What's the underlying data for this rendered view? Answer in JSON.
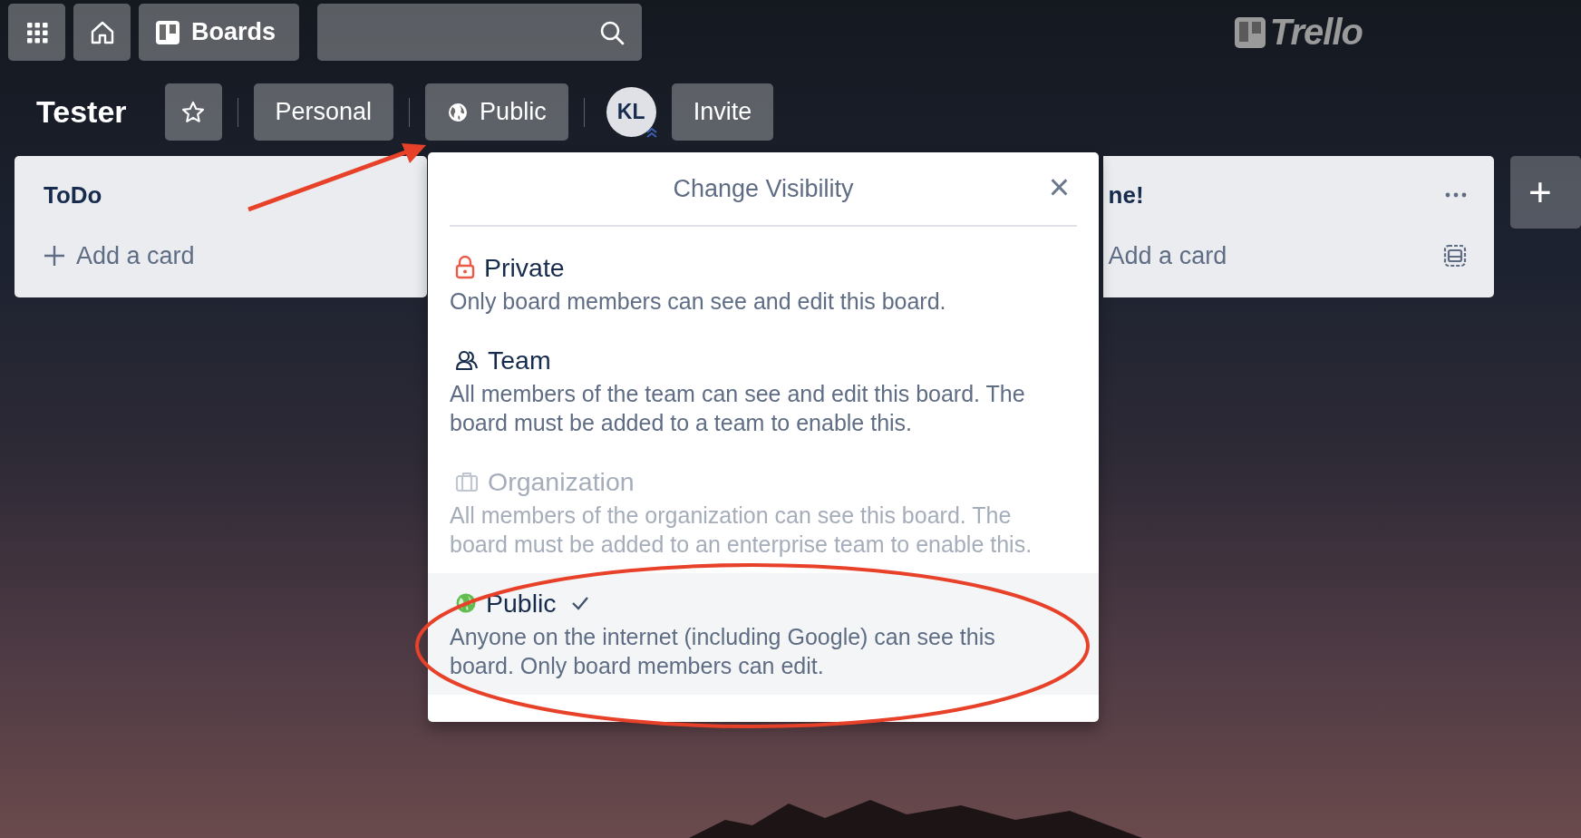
{
  "header": {
    "boards_label": "Boards",
    "logo_text": "Trello"
  },
  "board_bar": {
    "title": "Tester",
    "buttons": [
      {
        "kind": "star"
      },
      {
        "kind": "text",
        "label": "Personal"
      },
      {
        "kind": "globe",
        "label": "Public"
      }
    ],
    "member": {
      "initials": "KL"
    },
    "invite_label": "Invite"
  },
  "lists": [
    {
      "title": "ToDo",
      "add_label": "Add a card",
      "add_icon": true,
      "menu": false,
      "template_icon": false
    },
    {
      "title": "ne!",
      "add_label": "Add a card",
      "add_icon": false,
      "menu": true,
      "template_icon": true
    }
  ],
  "add_list": {
    "label": "+"
  },
  "popover": {
    "title": "Change Visibility",
    "close": "×",
    "options": [
      {
        "kind": "private",
        "title": "Private",
        "description": "Only board members can see and edit this board.",
        "selected": false,
        "disabled": false
      },
      {
        "kind": "team",
        "title": "Team",
        "description": "All members of the team can see and edit this board. The board must be added to a team to enable this.",
        "selected": false,
        "disabled": false
      },
      {
        "kind": "organization",
        "title": "Organization",
        "description": "All members of the organization can see this board. The board must be added to an enterprise team to enable this.",
        "selected": false,
        "disabled": true
      },
      {
        "kind": "public",
        "title": "Public",
        "description": "Anyone on the internet (including Google) can see this board. Only board members can edit.",
        "selected": true,
        "disabled": false
      }
    ]
  }
}
